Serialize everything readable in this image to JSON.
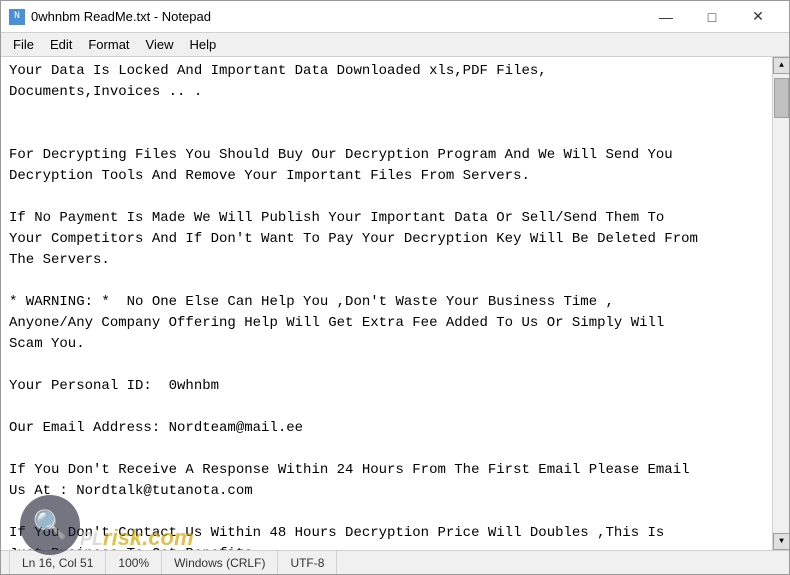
{
  "window": {
    "title": "0whnbm ReadMe.txt - Notepad",
    "icon_label": "N"
  },
  "title_buttons": {
    "minimize": "—",
    "maximize": "□",
    "close": "✕"
  },
  "menu": {
    "items": [
      "File",
      "Edit",
      "Format",
      "View",
      "Help"
    ]
  },
  "content": {
    "text": "Your Data Is Locked And Important Data Downloaded xls,PDF Files,\nDocuments,Invoices .. .\n\n\nFor Decrypting Files You Should Buy Our Decryption Program And We Will Send You\nDecryption Tools And Remove Your Important Files From Servers.\n\nIf No Payment Is Made We Will Publish Your Important Data Or Sell/Send Them To\nYour Competitors And If Don't Want To Pay Your Decryption Key Will Be Deleted From\nThe Servers.\n\n* WARNING: *  No One Else Can Help You ,Don't Waste Your Business Time ,\nAnyone/Any Company Offering Help Will Get Extra Fee Added To Us Or Simply Will\nScam You.\n\nYour Personal ID:  0whnbm\n\nOur Email Address: Nordteam@mail.ee\n\nIf You Don't Receive A Response Within 24 Hours From The First Email Please Email\nUs At : Nordtalk@tutanota.com\n\nIf You Don't Contact Us Within 48 Hours Decryption Price Will Doubles ,This Is\nJust Business To Get Benefits ."
  },
  "status_bar": {
    "line_col": "Ln 16, Col 51",
    "zoom": "100%",
    "line_ending": "Windows (CRLF)",
    "encoding": "UTF-8"
  },
  "watermark": {
    "site": "risk.com",
    "prefix": "PL",
    "icon": "🔍"
  }
}
